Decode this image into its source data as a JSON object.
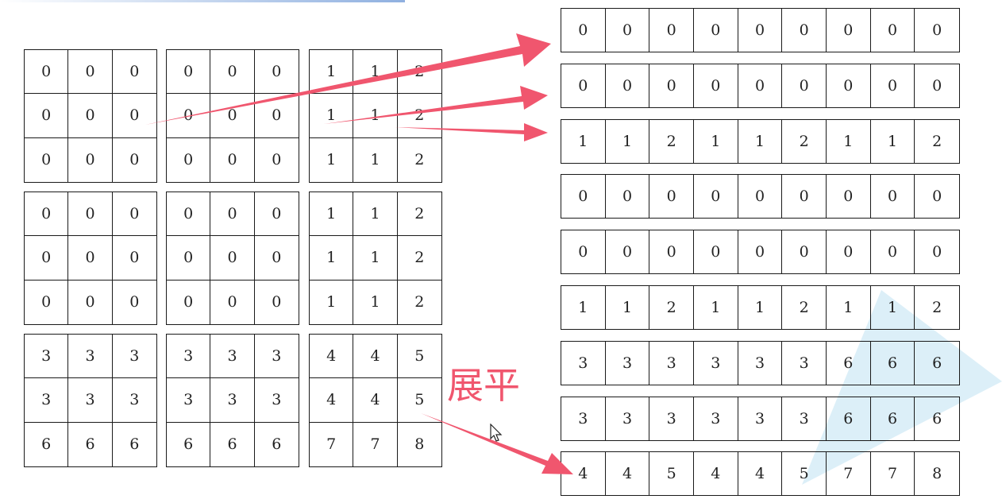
{
  "label": "展平",
  "colors": {
    "arrow": "#f0566e",
    "triangle": "#d6ecf7",
    "grid": "#1a1a1a"
  },
  "blocks": [
    [
      [
        "0",
        "0",
        "0"
      ],
      [
        "0",
        "0",
        "0"
      ],
      [
        "0",
        "0",
        "0"
      ]
    ],
    [
      [
        "0",
        "0",
        "0"
      ],
      [
        "0",
        "0",
        "0"
      ],
      [
        "0",
        "0",
        "0"
      ]
    ],
    [
      [
        "1",
        "1",
        "2"
      ],
      [
        "1",
        "1",
        "2"
      ],
      [
        "1",
        "1",
        "2"
      ]
    ],
    [
      [
        "0",
        "0",
        "0"
      ],
      [
        "0",
        "0",
        "0"
      ],
      [
        "0",
        "0",
        "0"
      ]
    ],
    [
      [
        "0",
        "0",
        "0"
      ],
      [
        "0",
        "0",
        "0"
      ],
      [
        "0",
        "0",
        "0"
      ]
    ],
    [
      [
        "1",
        "1",
        "2"
      ],
      [
        "1",
        "1",
        "2"
      ],
      [
        "1",
        "1",
        "2"
      ]
    ],
    [
      [
        "3",
        "3",
        "3"
      ],
      [
        "3",
        "3",
        "3"
      ],
      [
        "6",
        "6",
        "6"
      ]
    ],
    [
      [
        "3",
        "3",
        "3"
      ],
      [
        "3",
        "3",
        "3"
      ],
      [
        "6",
        "6",
        "6"
      ]
    ],
    [
      [
        "4",
        "4",
        "5"
      ],
      [
        "4",
        "4",
        "5"
      ],
      [
        "7",
        "7",
        "8"
      ]
    ]
  ],
  "rows": [
    [
      "0",
      "0",
      "0",
      "0",
      "0",
      "0",
      "0",
      "0",
      "0"
    ],
    [
      "0",
      "0",
      "0",
      "0",
      "0",
      "0",
      "0",
      "0",
      "0"
    ],
    [
      "1",
      "1",
      "2",
      "1",
      "1",
      "2",
      "1",
      "1",
      "2"
    ],
    [
      "0",
      "0",
      "0",
      "0",
      "0",
      "0",
      "0",
      "0",
      "0"
    ],
    [
      "0",
      "0",
      "0",
      "0",
      "0",
      "0",
      "0",
      "0",
      "0"
    ],
    [
      "1",
      "1",
      "2",
      "1",
      "1",
      "2",
      "1",
      "1",
      "2"
    ],
    [
      "3",
      "3",
      "3",
      "3",
      "3",
      "3",
      "6",
      "6",
      "6"
    ],
    [
      "3",
      "3",
      "3",
      "3",
      "3",
      "3",
      "6",
      "6",
      "6"
    ],
    [
      "4",
      "4",
      "5",
      "4",
      "4",
      "5",
      "7",
      "7",
      "8"
    ]
  ]
}
